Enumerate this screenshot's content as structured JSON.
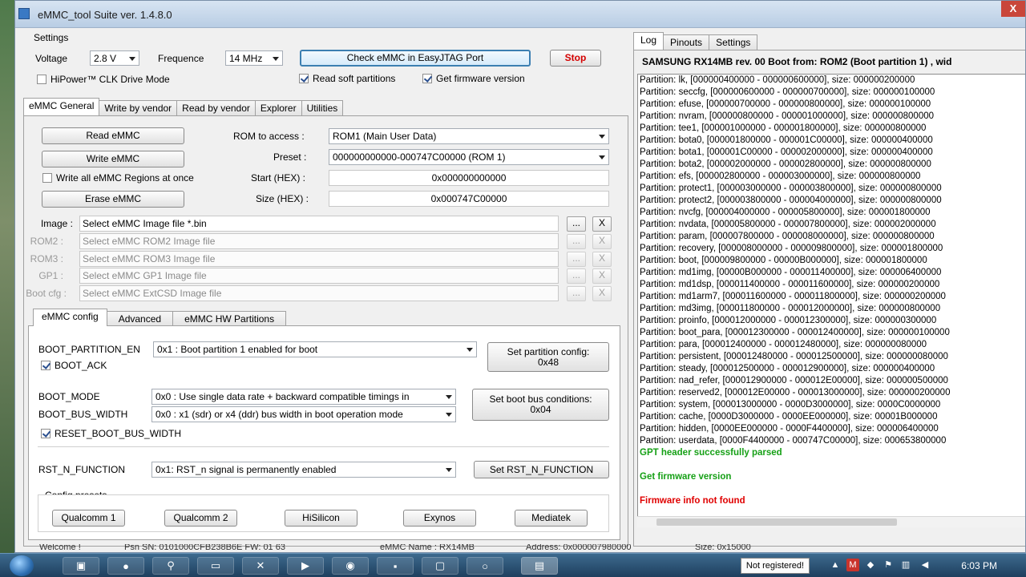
{
  "window": {
    "title": "eMMC_tool Suite  ver. 1.4.8.0",
    "close": "X"
  },
  "settings": {
    "group_label": "Settings",
    "voltage_label": "Voltage",
    "voltage_value": "2.8 V",
    "frequence_label": "Frequence",
    "frequence_value": "14 MHz",
    "check_button": "Check eMMC in EasyJTAG Port",
    "stop_button": "Stop",
    "hipower": "HiPower™ CLK Drive Mode",
    "read_soft": "Read soft partitions",
    "get_firmware": "Get firmware version"
  },
  "main_tabs": [
    "eMMC General",
    "Write by vendor",
    "Read by vendor",
    "Explorer",
    "Utilities"
  ],
  "general": {
    "read": "Read eMMC",
    "write": "Write eMMC",
    "write_all": "Write all eMMC Regions at once",
    "erase": "Erase eMMC",
    "rom_label": "ROM to access :",
    "rom_value": "ROM1 (Main User Data)",
    "preset_label": "Preset :",
    "preset_value": "000000000000-000747C00000 (ROM 1)",
    "start_label": "Start (HEX) :",
    "start_value": "0x000000000000",
    "size_label": "Size (HEX) :",
    "size_value": "0x000747C00000"
  },
  "images": [
    {
      "label": "Image :",
      "placeholder": "Select eMMC Image file *.bin",
      "browse": "...",
      "clear": "X"
    },
    {
      "label": "ROM2 :",
      "placeholder": "Select eMMC ROM2 Image file",
      "browse": "...",
      "clear": "X"
    },
    {
      "label": "ROM3 :",
      "placeholder": "Select eMMC ROM3 Image file",
      "browse": "...",
      "clear": "X"
    },
    {
      "label": "GP1 :",
      "placeholder": "Select eMMC GP1 Image file",
      "browse": "...",
      "clear": "X"
    },
    {
      "label": "Boot cfg :",
      "placeholder": "Select eMMC ExtCSD Image file",
      "browse": "...",
      "clear": "X"
    }
  ],
  "config_tabs": [
    "eMMC config",
    "Advanced",
    "eMMC HW Partitions"
  ],
  "config": {
    "boot_partition_label": "BOOT_PARTITION_EN",
    "boot_partition_value": "0x1 : Boot partition 1 enabled for boot",
    "boot_ack": "BOOT_ACK",
    "set_partition_btn_l1": "Set partition config:",
    "set_partition_btn_l2": "0x48",
    "boot_mode_label": "BOOT_MODE",
    "boot_mode_value": "0x0 : Use single data rate + backward compatible timings in",
    "boot_bus_width_label": "BOOT_BUS_WIDTH",
    "boot_bus_width_value": "0x0 : x1 (sdr) or x4 (ddr) bus width in boot operation mode",
    "set_boot_bus_l1": "Set boot bus conditions:",
    "set_boot_bus_l2": "0x04",
    "reset_boot_bus": "RESET_BOOT_BUS_WIDTH",
    "rst_label": "RST_N_FUNCTION",
    "rst_value": "0x1: RST_n signal is permanently enabled",
    "set_rst_btn": "Set RST_N_FUNCTION",
    "presets_label": "Config presets",
    "presets": [
      "Qualcomm 1",
      "Qualcomm 2",
      "HiSilicon",
      "Exynos",
      "Mediatek"
    ]
  },
  "log_tabs": [
    "Log",
    "Pinouts",
    "Settings"
  ],
  "log": {
    "header": "SAMSUNG   RX14MB   rev. 00     Boot from:  ROM2 (Boot partition 1) , wid",
    "lines": [
      "Partition: lk, [000000400000 - 000000600000], size: 000000200000",
      "Partition: seccfg, [000000600000 - 000000700000], size: 000000100000",
      "Partition: efuse, [000000700000 - 000000800000], size: 000000100000",
      "Partition: nvram, [000000800000 - 000001000000], size: 000000800000",
      "Partition: tee1, [000001000000 - 000001800000], size: 000000800000",
      "Partition: bota0, [000001800000 - 000001C00000], size: 000000400000",
      "Partition: bota1, [000001C00000 - 000002000000], size: 000000400000",
      "Partition: bota2, [000002000000 - 000002800000], size: 000000800000",
      "Partition: efs, [000002800000 - 000003000000], size: 000000800000",
      "Partition: protect1, [000003000000 - 000003800000], size: 000000800000",
      "Partition: protect2, [000003800000 - 000004000000], size: 000000800000",
      "Partition: nvcfg, [000004000000 - 000005800000], size: 000001800000",
      "Partition: nvdata, [000005800000 - 000007800000], size: 000002000000",
      "Partition: param, [000007800000 - 000008000000], size: 000000800000",
      "Partition: recovery, [000008000000 - 000009800000], size: 000001800000",
      "Partition: boot, [000009800000 - 00000B000000], size: 000001800000",
      "Partition: md1img, [00000B000000 - 000011400000], size: 000006400000",
      "Partition: md1dsp, [000011400000 - 000011600000], size: 000000200000",
      "Partition: md1arm7, [000011600000 - 000011800000], size: 000000200000",
      "Partition: md3img, [000011800000 - 000012000000], size: 000000800000",
      "Partition: proinfo, [000012000000 - 000012300000], size: 000000300000",
      "Partition: boot_para, [000012300000 - 000012400000], size: 000000100000",
      "Partition: para, [000012400000 - 000012480000], size: 000000080000",
      "Partition: persistent, [000012480000 - 000012500000], size: 000000080000",
      "Partition: steady, [000012500000 - 000012900000], size: 000000400000",
      "Partition: nad_refer, [000012900000 - 000012E00000], size: 000000500000",
      "Partition: reserved2, [000012E00000 - 000013000000], size: 000000200000",
      "Partition: system, [000013000000 - 0000D3000000], size: 0000C0000000",
      "Partition: cache, [0000D3000000 - 0000EE000000], size: 00001B000000",
      "Partition: hidden, [0000EE000000 - 0000F4400000], size: 000006400000",
      "Partition: userdata, [0000F4400000 - 000747C00000], size: 000653800000"
    ],
    "gpt_ok": "GPT header successfully parsed",
    "get_fw": "Get firmware version",
    "fw_not_found": "Firmware info not found"
  },
  "statusbar": {
    "welcome": "Welcome !",
    "psn": "Psn SN: 0101000CFB238B6E  FW: 01 63",
    "name": "eMMC Name : RX14MB",
    "address": "Address: 0x000007980000",
    "size": "Size: 0x15000"
  },
  "taskbar": {
    "not_registered": "Not registered!",
    "clock": "6:03 PM"
  }
}
